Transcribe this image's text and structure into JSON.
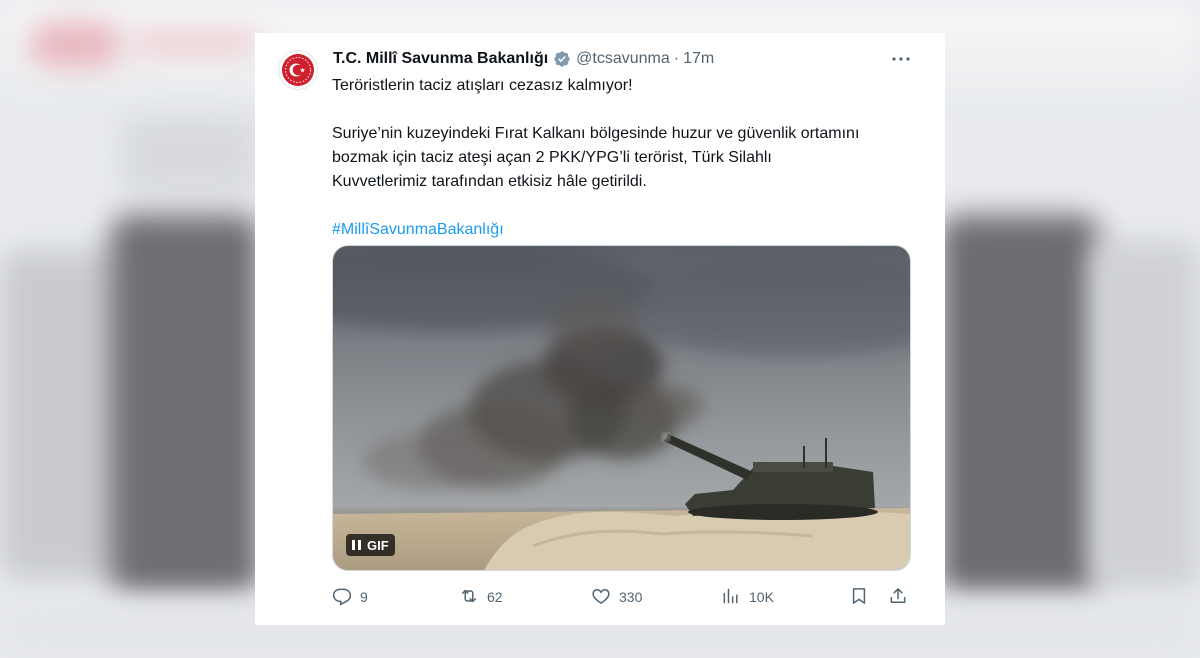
{
  "tweet": {
    "display_name": "T.C. Millî Savunma Bakanlığı",
    "handle": "@tcsavunma",
    "separator": "·",
    "time": "17m",
    "text_line1": "Teröristlerin taciz atışları cezasız kalmıyor!",
    "text_para2_line1": "Suriye’nin kuzeyindeki Fırat Kalkanı bölgesinde huzur ve güvenlik ortamını",
    "text_para2_line2": "bozmak için taciz ateşi açan 2 PKK/YPG’li terörist, Türk Silahlı",
    "text_para2_line3": "Kuvvetlerimiz tarafından etkisiz hâle getirildi.",
    "hashtag": "#MillîSavunmaBakanlığı",
    "gif_label": "GIF",
    "accent_color": "#1d9bf0",
    "avatar_color": "#d0202e"
  },
  "actions": {
    "replies": "9",
    "retweets": "62",
    "likes": "330",
    "views": "10K"
  },
  "icons": {
    "verified": "verified-badge-icon",
    "more": "more-icon",
    "reply": "reply-icon",
    "retweet": "retweet-icon",
    "like": "heart-icon",
    "views": "views-icon",
    "bookmark": "bookmark-icon",
    "share": "share-icon",
    "pause": "pause-icon"
  }
}
